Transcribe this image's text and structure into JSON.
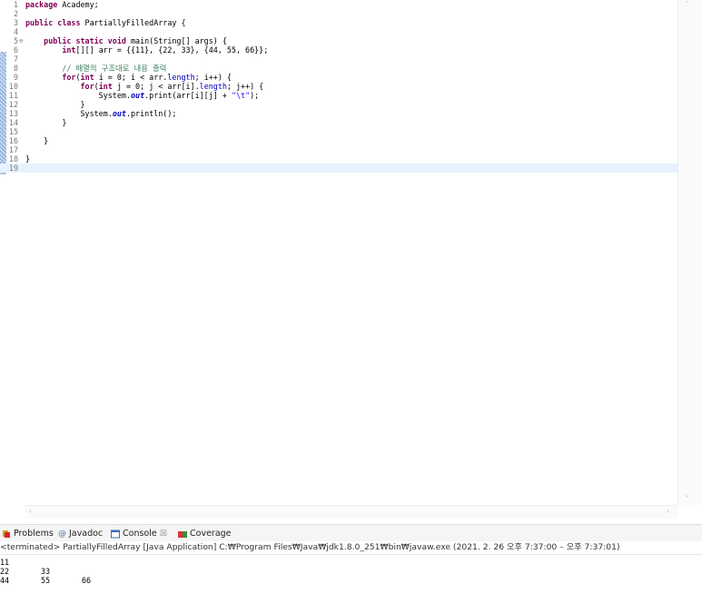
{
  "editor": {
    "lines": [
      {
        "n": "1",
        "html": "<span class=\"kw\">package</span> Academy;"
      },
      {
        "n": "2",
        "html": ""
      },
      {
        "n": "3",
        "html": "<span class=\"kw\">public class</span> PartiallyFilledArray {"
      },
      {
        "n": "4",
        "html": ""
      },
      {
        "n": "5",
        "fold": "⊖",
        "html": "    <span class=\"kw\">public static void</span> main(String[] args) {"
      },
      {
        "n": "6",
        "html": "        <span class=\"kw\">int</span>[][] arr = {{11}, {22, 33}, {44, 55, 66}};"
      },
      {
        "n": "7",
        "html": ""
      },
      {
        "n": "8",
        "html": "        <span class=\"cm\">// 배열의 구조대로 내용 출력</span>"
      },
      {
        "n": "9",
        "html": "        <span class=\"kw\">for</span>(<span class=\"kw\">int</span> i = 0; i &lt; arr.<span class=\"fld\">length</span>; i++) {"
      },
      {
        "n": "10",
        "html": "            <span class=\"kw\">for</span>(<span class=\"kw\">int</span> j = 0; j &lt; arr[i].<span class=\"fld\">length</span>; j++) {"
      },
      {
        "n": "11",
        "html": "                System.<span class=\"sfld\">out</span>.print(arr[i][j] + <span class=\"str\">\"\\t\"</span>);"
      },
      {
        "n": "12",
        "html": "            }"
      },
      {
        "n": "13",
        "html": "            System.<span class=\"sfld\">out</span>.println();"
      },
      {
        "n": "14",
        "html": "        }"
      },
      {
        "n": "15",
        "html": ""
      },
      {
        "n": "16",
        "html": "    }"
      },
      {
        "n": "17",
        "html": ""
      },
      {
        "n": "18",
        "html": "}"
      },
      {
        "n": "19",
        "html": ""
      }
    ],
    "current_line": 19
  },
  "tabs": {
    "problems": "Problems",
    "javadoc": "Javadoc",
    "console": "Console",
    "console_close": "☒",
    "coverage": "Coverage"
  },
  "console": {
    "header": "<terminated> PartiallyFilledArray [Java Application] C:₩Program Files₩Java₩jdk1.8.0_251₩bin₩javaw.exe  (2021. 2. 26 오후 7:37:00 – 오후 7:37:01)",
    "rows": [
      [
        "11"
      ],
      [
        "22",
        "33"
      ],
      [
        "44",
        "55",
        "66"
      ]
    ]
  }
}
